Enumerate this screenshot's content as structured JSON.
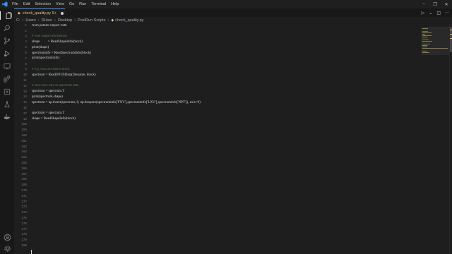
{
  "titlebar": {
    "menu": [
      "File",
      "Edit",
      "Selection",
      "View",
      "Go",
      "Run",
      "Terminal",
      "Help"
    ]
  },
  "tab": {
    "label": "check_quality.py 9+"
  },
  "breadcrumb": [
    "C:",
    "Users",
    "DUser",
    "Desktop",
    "PostRun Scripts",
    "check_quality.py"
  ],
  "editor": {
    "code_lines": [
      {
        "ln": "1",
        "text": "from pathlib import Path",
        "type": "code"
      },
      {
        "ln": "2",
        "text": "",
        "type": "code"
      },
      {
        "ln": "3",
        "text": "# read shape information",
        "type": "comment"
      },
      {
        "ln": "4",
        "text": "shape         = ReadShapeInfo(block)",
        "type": "code"
      },
      {
        "ln": "5",
        "text": "print(shape)",
        "type": "code"
      },
      {
        "ln": "6",
        "text": "spectruminfo = ReadSpectrumInfo(block)",
        "type": "code"
      },
      {
        "ln": "7",
        "text": "print(spectruminfo)",
        "type": "code"
      },
      {
        "ln": "8",
        "text": "",
        "type": "code"
      },
      {
        "ln": "9",
        "text": "# e.g. read 2D spectr block",
        "type": "comment"
      },
      {
        "ln": "10",
        "text": "spectrum = ReadOPUSData(filename, block)",
        "type": "code"
      },
      {
        "ln": "11",
        "text": "",
        "type": "code"
      },
      {
        "ln": "12",
        "text": "# add wave info to spectrum data",
        "type": "comment"
      },
      {
        "ln": "13",
        "text": "spectrum = spectrum.T",
        "type": "code"
      },
      {
        "ln": "14",
        "text": "print(spectrum.shape)",
        "type": "code"
      },
      {
        "ln": "15",
        "text": "spectrum = np.insert(spectrum, 0, np.linspace(spectruminfo['FXV'],spectruminfo['LXV'],spectruminfo['NPT']), axis=0)",
        "type": "code"
      },
      {
        "ln": "16",
        "text": "",
        "type": "code"
      },
      {
        "ln": "17",
        "text": "spectrum = spectrum.T",
        "type": "code"
      },
      {
        "ln": "18",
        "text": "shape = ReadShapeInfo(block)",
        "type": "code"
      }
    ],
    "empty_line_numbers": [
      "158",
      "159",
      "160",
      "161",
      "162",
      "163",
      "164",
      "165",
      "166",
      "167",
      "168",
      "169",
      "170",
      "171",
      "172",
      "173",
      "174",
      "175",
      "176",
      "177",
      "178",
      "179",
      "180",
      "181",
      "182",
      "183",
      "184",
      "185",
      "186",
      "187",
      "188",
      "189",
      "190",
      "191",
      "192",
      "193",
      "194",
      "195"
    ],
    "colors": {
      "background": "#1e1e1e",
      "comment": "#6a9955",
      "text": "#d4d4d4",
      "tab_modified": "#e2c08d",
      "accent": "#3794ff"
    }
  },
  "icons": {
    "activity": [
      "explorer-icon",
      "search-icon",
      "source-control-icon",
      "run-debug-icon",
      "extensions-icon",
      "remote-explorer-icon",
      "testing-icon",
      "docker-icon",
      "accounts-icon",
      "settings-gear-icon"
    ]
  }
}
